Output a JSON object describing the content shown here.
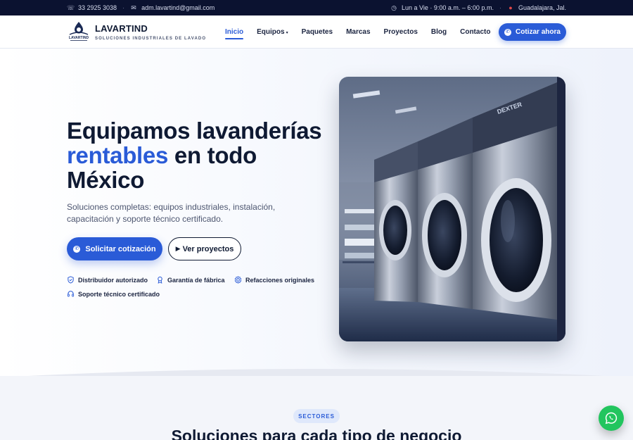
{
  "topbar": {
    "phone": "33 2925 3038",
    "email": "adm.lavartind@gmail.com",
    "hours": "Lun a Vie · 9:00 a.m. – 6:00 p.m.",
    "location": "Guadalajara, Jal."
  },
  "brand": {
    "name": "LAVARTIND",
    "tagline": "SOLUCIONES INDUSTRIALES DE LAVADO",
    "logo_text": "LAVARTIND"
  },
  "nav": {
    "items": [
      {
        "label": "Inicio",
        "active": true
      },
      {
        "label": "Equipos",
        "dropdown": true
      },
      {
        "label": "Paquetes"
      },
      {
        "label": "Marcas"
      },
      {
        "label": "Proyectos"
      },
      {
        "label": "Blog"
      },
      {
        "label": "Contacto"
      }
    ],
    "cta": "Cotizar ahora"
  },
  "hero": {
    "title_line1": "Equipamos lavanderías",
    "title_accent": "rentables",
    "title_line2_rest": " en todo",
    "title_line3": "México",
    "lead": "Soluciones completas: equipos industriales, instalación, capacitación y soporte técnico certificado.",
    "primary_cta": "Solicitar cotización",
    "secondary_cta": "Ver proyectos",
    "secondary_icon": "play-icon",
    "badges": [
      {
        "icon": "shield-icon",
        "label": "Distribuidor autorizado"
      },
      {
        "icon": "award-icon",
        "label": "Garantía de fábrica"
      },
      {
        "icon": "gear-icon",
        "label": "Refacciones originales"
      },
      {
        "icon": "headset-icon",
        "label": "Soporte técnico certificado"
      }
    ],
    "image_brand_text": "DEXTER"
  },
  "sectors": {
    "pill": "SECTORES",
    "title": "Soluciones para cada tipo de negocio"
  },
  "colors": {
    "primary": "#2a5bd7",
    "dark": "#0f1a33",
    "topbar": "#0b1230",
    "whatsapp": "#22c55e"
  }
}
